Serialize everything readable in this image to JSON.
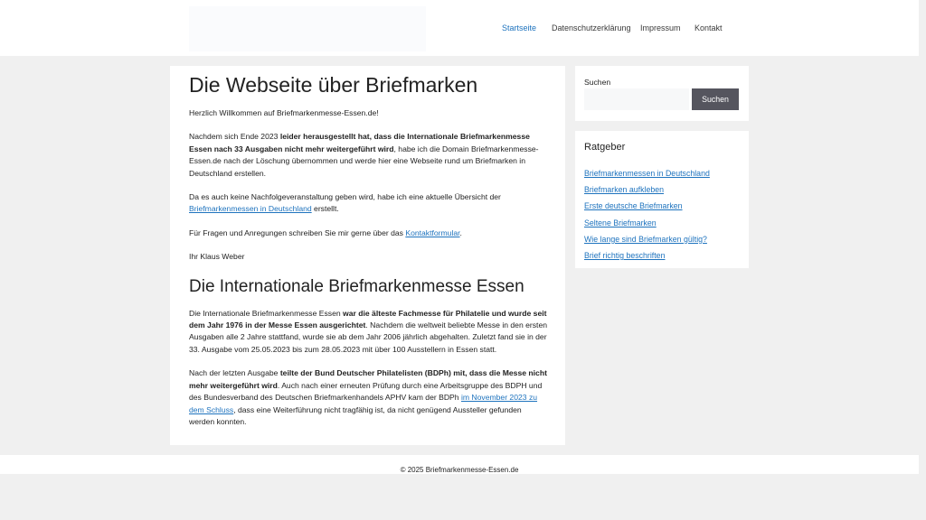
{
  "nav": {
    "items": [
      {
        "label": "Startseite",
        "active": true
      },
      {
        "label": "Datenschutzerklärung",
        "active": false
      },
      {
        "label": "Impressum",
        "active": false
      },
      {
        "label": "Kontakt",
        "active": false
      }
    ]
  },
  "main": {
    "h1": "Die Webseite über Briefmarken",
    "p1": "Herzlich Willkommen auf Briefmarkenmesse-Essen.de!",
    "p2": {
      "a": "Nachdem sich Ende 2023 ",
      "b": "leider herausgestellt hat, dass die Internationale Briefmarkenmesse Essen nach 33 Ausgaben nicht mehr weitergeführt wird",
      "c": ", habe ich die Domain Briefmarkenmesse-Essen.de nach der Löschung übernommen und werde hier eine Webseite rund um Briefmarken in Deutschland erstellen."
    },
    "p3": {
      "a": "Da es auch keine Nachfolgeveranstaltung geben wird, habe ich eine aktuelle Übersicht der ",
      "link": "Briefmarkenmessen in Deutschland",
      "c": " erstellt."
    },
    "p4": {
      "a": "Für Fragen und Anregungen schreiben Sie mir gerne über das ",
      "link": "Kontaktformular",
      "c": "."
    },
    "p5": "Ihr Klaus Weber",
    "h2": "Die Internationale Briefmarkenmesse Essen",
    "p6": {
      "a": "Die Internationale Briefmarkenmesse Essen ",
      "b": "war die älteste Fachmesse für Philatelie und wurde seit dem Jahr 1976 in der Messe Essen ausgerichtet",
      "c": ". Nachdem die weltweit beliebte Messe in den ersten Ausgaben alle 2 Jahre stattfand, wurde sie ab dem Jahr 2006 jährlich abgehalten. Zuletzt fand sie in der 33. Ausgabe vom 25.05.2023 bis zum 28.05.2023 mit über 100 Ausstellern in Essen statt."
    },
    "p7": {
      "a": "Nach der letzten Ausgabe ",
      "b": "teilte der Bund Deutscher Philatelisten (BDPh) mit, dass die Messe nicht mehr weitergeführt wird",
      "c": ". Auch nach einer erneuten Prüfung durch eine Arbeitsgruppe des BDPH und des Bundesverband des Deutschen Briefmarkenhandels APHV kam der BDPh ",
      "link": "im November 2023 zu dem Schluss",
      "d": ", dass eine Weiterführung nicht tragfähig ist, da nicht genügend Aussteller gefunden werden konnten."
    }
  },
  "sidebar": {
    "search": {
      "label": "Suchen",
      "placeholder": "",
      "button": "Suchen"
    },
    "ratgeber": {
      "title": "Ratgeber",
      "items": [
        "Briefmarkenmessen in Deutschland",
        "Briefmarken aufkleben",
        "Erste deutsche Briefmarken",
        "Seltene Briefmarken",
        "Wie lange sind Briefmarken gültig?",
        "Brief richtig beschriften"
      ]
    }
  },
  "footer": {
    "text": "© 2025 Briefmarkenmesse-Essen.de"
  },
  "colors": {
    "link": "#1e73be",
    "button": "#55555e",
    "page_bg": "#f0f0f0"
  }
}
